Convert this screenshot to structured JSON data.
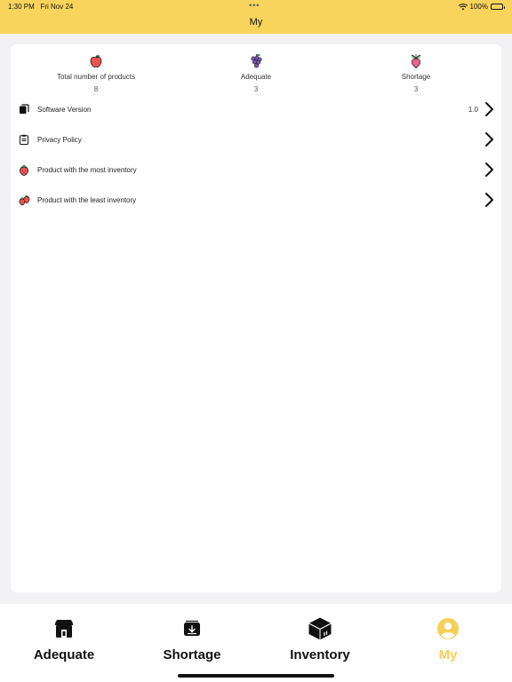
{
  "status_bar": {
    "time": "1:30 PM",
    "date": "Fri Nov 24",
    "battery": "100%"
  },
  "header": {
    "title": "My"
  },
  "stats": [
    {
      "label": "Total number of products",
      "value": "8",
      "icon": "apple-icon"
    },
    {
      "label": "Adequate",
      "value": "3",
      "icon": "grapes-icon"
    },
    {
      "label": "Shortage",
      "value": "3",
      "icon": "radish-icon"
    }
  ],
  "menu": [
    {
      "label": "Software Version",
      "extra": "1.0",
      "icon": "copy-icon"
    },
    {
      "label": "Privacy Policy",
      "extra": "",
      "icon": "clipboard-icon"
    },
    {
      "label": "Product with the most inventory",
      "extra": "",
      "icon": "strawberry-icon"
    },
    {
      "label": "Product with the least inventory",
      "extra": "",
      "icon": "strawberries-icon"
    }
  ],
  "tabs": [
    {
      "label": "Adequate",
      "icon": "store-icon"
    },
    {
      "label": "Shortage",
      "icon": "inbox-icon"
    },
    {
      "label": "Inventory",
      "icon": "box-icon"
    },
    {
      "label": "My",
      "icon": "person-icon"
    }
  ],
  "colors": {
    "accent": "#f9d45c",
    "active_tab": "#f5cf57"
  }
}
